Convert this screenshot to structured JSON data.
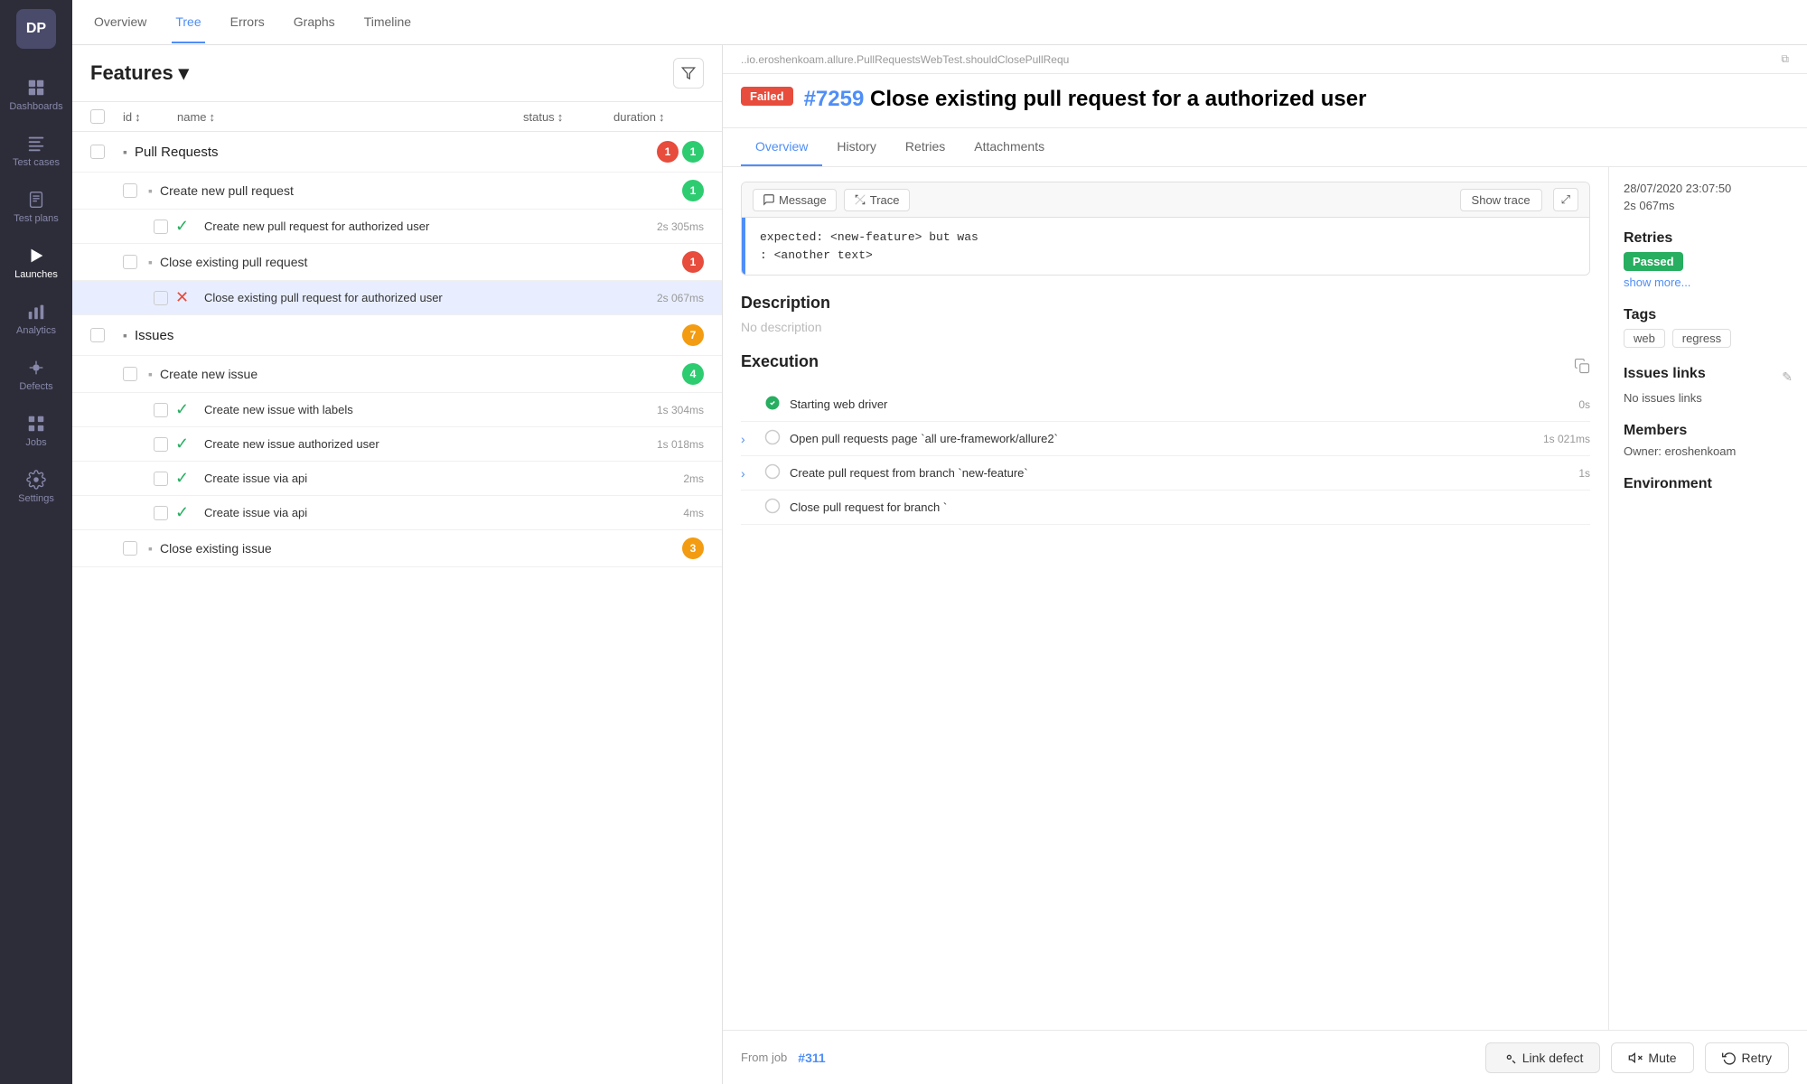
{
  "app": {
    "logo": "DP"
  },
  "sidebar": {
    "items": [
      {
        "id": "dashboards",
        "label": "Dashboards",
        "icon": "grid-icon"
      },
      {
        "id": "test-cases",
        "label": "Test cases",
        "icon": "list-icon",
        "active": false
      },
      {
        "id": "test-plans",
        "label": "Test plans",
        "icon": "clipboard-icon"
      },
      {
        "id": "launches",
        "label": "Launches",
        "icon": "play-icon",
        "active": true
      },
      {
        "id": "analytics",
        "label": "Analytics",
        "icon": "chart-icon"
      },
      {
        "id": "defects",
        "label": "Defects",
        "icon": "bug-icon"
      },
      {
        "id": "jobs",
        "label": "Jobs",
        "icon": "grid2-icon"
      },
      {
        "id": "settings",
        "label": "Settings",
        "icon": "gear-icon"
      }
    ]
  },
  "top_nav": {
    "tabs": [
      {
        "id": "overview",
        "label": "Overview"
      },
      {
        "id": "tree",
        "label": "Tree",
        "active": true
      },
      {
        "id": "errors",
        "label": "Errors"
      },
      {
        "id": "graphs",
        "label": "Graphs"
      },
      {
        "id": "timeline",
        "label": "Timeline"
      }
    ]
  },
  "left_panel": {
    "header": {
      "title": "Features",
      "chevron": "▾",
      "filter_icon": "filter-icon"
    },
    "table_header": {
      "id_col": "id",
      "name_col": "name",
      "status_col": "status",
      "duration_col": "duration"
    },
    "groups": [
      {
        "name": "Pull Requests",
        "badges": [
          {
            "value": "1",
            "type": "red"
          },
          {
            "value": "1",
            "type": "green"
          }
        ],
        "subgroups": [
          {
            "name": "Create new pull request",
            "badges": [
              {
                "value": "1",
                "type": "green"
              }
            ],
            "tests": [
              {
                "name": "Create new pull request for authorized user",
                "status": "pass",
                "duration": "2s 305ms",
                "selected": false
              }
            ]
          },
          {
            "name": "Close existing pull request",
            "badges": [
              {
                "value": "1",
                "type": "red"
              }
            ],
            "tests": [
              {
                "name": "Close existing pull request for authorized user",
                "status": "fail",
                "duration": "2s 067ms",
                "selected": true
              }
            ]
          }
        ]
      },
      {
        "name": "Issues",
        "badges": [
          {
            "value": "7",
            "type": "orange"
          }
        ],
        "subgroups": [
          {
            "name": "Create new issue",
            "badges": [
              {
                "value": "4",
                "type": "green"
              }
            ],
            "tests": [
              {
                "name": "Create new issue with labels",
                "status": "pass",
                "duration": "1s 304ms",
                "selected": false
              },
              {
                "name": "Create new issue authorized user",
                "status": "pass",
                "duration": "1s 018ms",
                "selected": false
              },
              {
                "name": "Create issue via api",
                "status": "pass",
                "duration": "2ms",
                "selected": false
              },
              {
                "name": "Create issue via api",
                "status": "pass",
                "duration": "4ms",
                "selected": false
              }
            ]
          }
        ]
      },
      {
        "name": "Close existing issue",
        "badges": [
          {
            "value": "3",
            "type": "orange"
          }
        ],
        "subgroups": [],
        "is_subgroup": true
      }
    ]
  },
  "right_panel": {
    "breadcrumb": "..io.eroshenkoam.allure.PullRequestsWebTest.shouldClosePullRequ",
    "failed_badge": "Failed",
    "test_id": "#7259",
    "test_title": "Close existing pull request for a authorized user",
    "detail_tabs": [
      {
        "id": "overview",
        "label": "Overview",
        "active": true
      },
      {
        "id": "history",
        "label": "History"
      },
      {
        "id": "retries",
        "label": "Retries"
      },
      {
        "id": "attachments",
        "label": "Attachments"
      }
    ],
    "message_area": {
      "message_btn": "Message",
      "trace_btn": "Trace",
      "show_trace_btn": "Show trace",
      "error_text": "expected: <new-feature> but was\n: <another text>"
    },
    "description": {
      "title": "Description",
      "value": "No description"
    },
    "execution": {
      "title": "Execution",
      "steps": [
        {
          "status": "pass",
          "text": "Starting web driver",
          "duration": "0s",
          "has_children": false
        },
        {
          "status": "none",
          "text": "Open pull requests page `all ure-framework/allure2`",
          "duration": "1s 021ms",
          "has_children": true
        },
        {
          "status": "none",
          "text": "Create pull request from branch `new-feature`",
          "duration": "1s",
          "has_children": true
        },
        {
          "status": "none",
          "text": "Close pull request for branch `",
          "duration": "",
          "has_children": false
        }
      ]
    },
    "sidebar": {
      "timestamp": "28/07/2020 23:07:50",
      "duration": "2s 067ms",
      "retries": {
        "title": "Retries",
        "badge": "Passed",
        "show_more": "show more..."
      },
      "tags": {
        "title": "Tags",
        "items": [
          "web",
          "regress"
        ]
      },
      "issues_links": {
        "title": "Issues links",
        "value": "No issues links"
      },
      "members": {
        "title": "Members",
        "owner_label": "Owner:",
        "owner_value": "eroshenkoam"
      },
      "environment": {
        "title": "Environment"
      }
    }
  },
  "bottom_bar": {
    "from_job_label": "From job",
    "job_link": "#311",
    "link_defect_btn": "Link defect",
    "mute_btn": "Mute",
    "retry_btn": "Retry"
  }
}
